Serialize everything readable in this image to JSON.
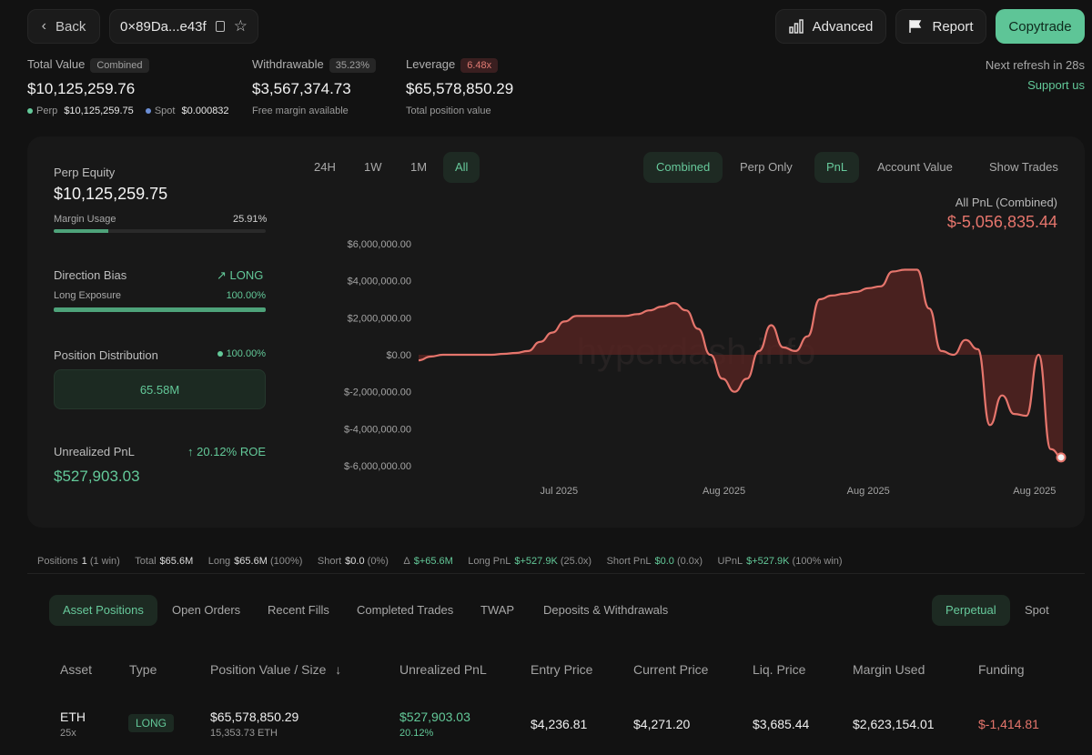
{
  "header": {
    "back_label": "Back",
    "address": "0×89Da...e43f",
    "advanced_label": "Advanced",
    "report_label": "Report",
    "copytrade_label": "Copytrade"
  },
  "summary": {
    "total_value_label": "Total Value",
    "total_value_tag": "Combined",
    "total_value": "$10,125,259.76",
    "perp_label": "Perp",
    "perp_value": "$10,125,259.75",
    "spot_label": "Spot",
    "spot_value": "$0.000832",
    "withdrawable_label": "Withdrawable",
    "withdrawable_tag": "35.23%",
    "withdrawable_value": "$3,567,374.73",
    "withdrawable_sub": "Free margin available",
    "leverage_label": "Leverage",
    "leverage_tag": "6.48x",
    "leverage_value": "$65,578,850.29",
    "leverage_sub": "Total position value",
    "refresh_text": "Next refresh in 28s",
    "support_label": "Support us"
  },
  "left_panel": {
    "perp_equity_label": "Perp Equity",
    "perp_equity_value": "$10,125,259.75",
    "margin_usage_label": "Margin Usage",
    "margin_usage_value": "25.91%",
    "margin_usage_fraction": 0.2591,
    "direction_bias_label": "Direction Bias",
    "direction_bias_value": "LONG",
    "long_exposure_label": "Long Exposure",
    "long_exposure_value": "100.00%",
    "long_exposure_fraction": 1.0,
    "position_distribution_label": "Position Distribution",
    "position_distribution_pct": "100.00%",
    "position_distribution_value": "65.58M",
    "unrealized_pnl_label": "Unrealized PnL",
    "roe_value": "20.12% ROE",
    "unrealized_pnl_value": "$527,903.03"
  },
  "chart_controls": {
    "ranges": [
      "24H",
      "1W",
      "1M",
      "All"
    ],
    "active_range": "All",
    "modes": [
      "Combined",
      "Perp Only"
    ],
    "metrics": [
      "PnL",
      "Account Value"
    ],
    "show_trades_label": "Show Trades",
    "chart_label": "All PnL (Combined)",
    "chart_value": "$-5,056,835.44",
    "watermark": "hyperdash.info"
  },
  "chart_data": {
    "type": "area",
    "ylim": [
      -6000000,
      6000000
    ],
    "y_ticks": [
      "$6,000,000.00",
      "$4,000,000.00",
      "$2,000,000.00",
      "$0.00",
      "$-2,000,000.00",
      "$-4,000,000.00",
      "$-6,000,000.00"
    ],
    "x_ticks": [
      "Jul 2025",
      "Aug 2025",
      "Aug 2025",
      "Aug 2025"
    ],
    "color": "#e5756c",
    "values": [
      -300000,
      -100000,
      0,
      0,
      0,
      0,
      0,
      50000,
      100000,
      200000,
      700000,
      1200000,
      1800000,
      2100000,
      2100000,
      2100000,
      2100000,
      2100000,
      2200000,
      2400000,
      2600000,
      2800000,
      2400000,
      1400000,
      0,
      -1300000,
      -2000000,
      -1300000,
      200000,
      1600000,
      400000,
      200000,
      1000000,
      3000000,
      3200000,
      3300000,
      3400000,
      3600000,
      3700000,
      4500000,
      4600000,
      4600000,
      2500000,
      200000,
      0,
      800000,
      300000,
      -3800000,
      -2200000,
      -3200000,
      -3300000,
      0,
      -5100000,
      -5600000
    ],
    "marker_value": -5056835.44
  },
  "stats_bar": {
    "positions_label": "Positions",
    "positions_value": "1",
    "positions_sub": "(1 win)",
    "total_label": "Total",
    "total_value": "$65.6M",
    "long_label": "Long",
    "long_value": "$65.6M",
    "long_sub": "(100%)",
    "short_label": "Short",
    "short_value": "$0.0",
    "short_sub": "(0%)",
    "delta_label": "Δ",
    "delta_value": "$+65.6M",
    "long_pnl_label": "Long PnL",
    "long_pnl_value": "$+527.9K",
    "long_pnl_sub": "(25.0x)",
    "short_pnl_label": "Short PnL",
    "short_pnl_value": "$0.0",
    "short_pnl_sub": "(0.0x)",
    "upnl_label": "UPnL",
    "upnl_value": "$+527.9K",
    "upnl_sub": "(100% win)"
  },
  "tabs": {
    "items": [
      "Asset Positions",
      "Open Orders",
      "Recent Fills",
      "Completed Trades",
      "TWAP",
      "Deposits & Withdrawals"
    ],
    "active": "Asset Positions",
    "market_tabs": [
      "Perpetual",
      "Spot"
    ],
    "active_market": "Perpetual"
  },
  "table": {
    "headers": [
      "Asset",
      "Type",
      "Position Value / Size",
      "Unrealized PnL",
      "Entry Price",
      "Current Price",
      "Liq. Price",
      "Margin Used",
      "Funding"
    ],
    "rows": [
      {
        "asset": "ETH",
        "leverage": "25x",
        "type": "LONG",
        "position_value": "$65,578,850.29",
        "size": "15,353.73 ETH",
        "unrealized_pnl": "$527,903.03",
        "unrealized_pct": "20.12%",
        "entry_price": "$4,236.81",
        "current_price": "$4,271.20",
        "liq_price": "$3,685.44",
        "margin_used": "$2,623,154.01",
        "funding": "$-1,414.81"
      }
    ]
  }
}
